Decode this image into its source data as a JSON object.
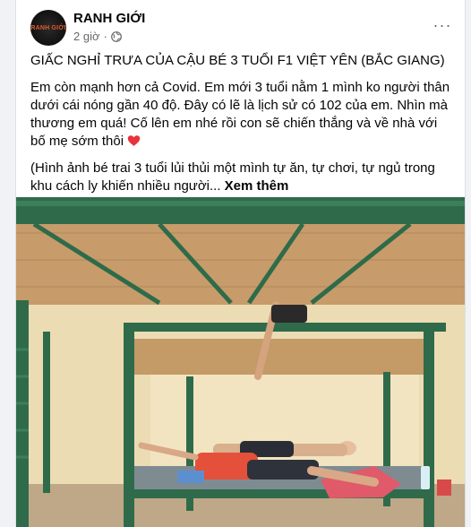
{
  "post": {
    "page_name": "RANH GIỚI",
    "avatar_text": "RANH GIỚI",
    "time": "2 giờ",
    "separator": "·",
    "more_label": "···",
    "headline": "GIẤC NGHỈ TRƯA CỦA CẬU BÉ 3 TUỔI F1 VIỆT YÊN (BẮC GIANG)",
    "paragraph_1": "Em còn mạnh hơn cả Covid. Em mới 3 tuổi nằm 1 mình ko người thân dưới cái nóng gần 40 độ. Đây có lẽ là lịch sử có 102 của em. Nhìn mà thương em quá! Cố lên em nhé rồi con sẽ chiến thắng và về nhà với bố mẹ sớm thôi",
    "paragraph_2": "(Hình ảnh bé trai 3 tuổi lủi thủi một mình tự ăn, tự chơi, tự ngủ trong khu cách ly khiến nhiều người...",
    "see_more": "Xem thêm"
  },
  "icons": {
    "globe": "globe-icon",
    "heart": "red-heart-icon",
    "more": "more-options-icon"
  },
  "colors": {
    "bunk_frame": "#2f6b4a",
    "heart": "#e8323c",
    "secondary_text": "#65676b"
  }
}
